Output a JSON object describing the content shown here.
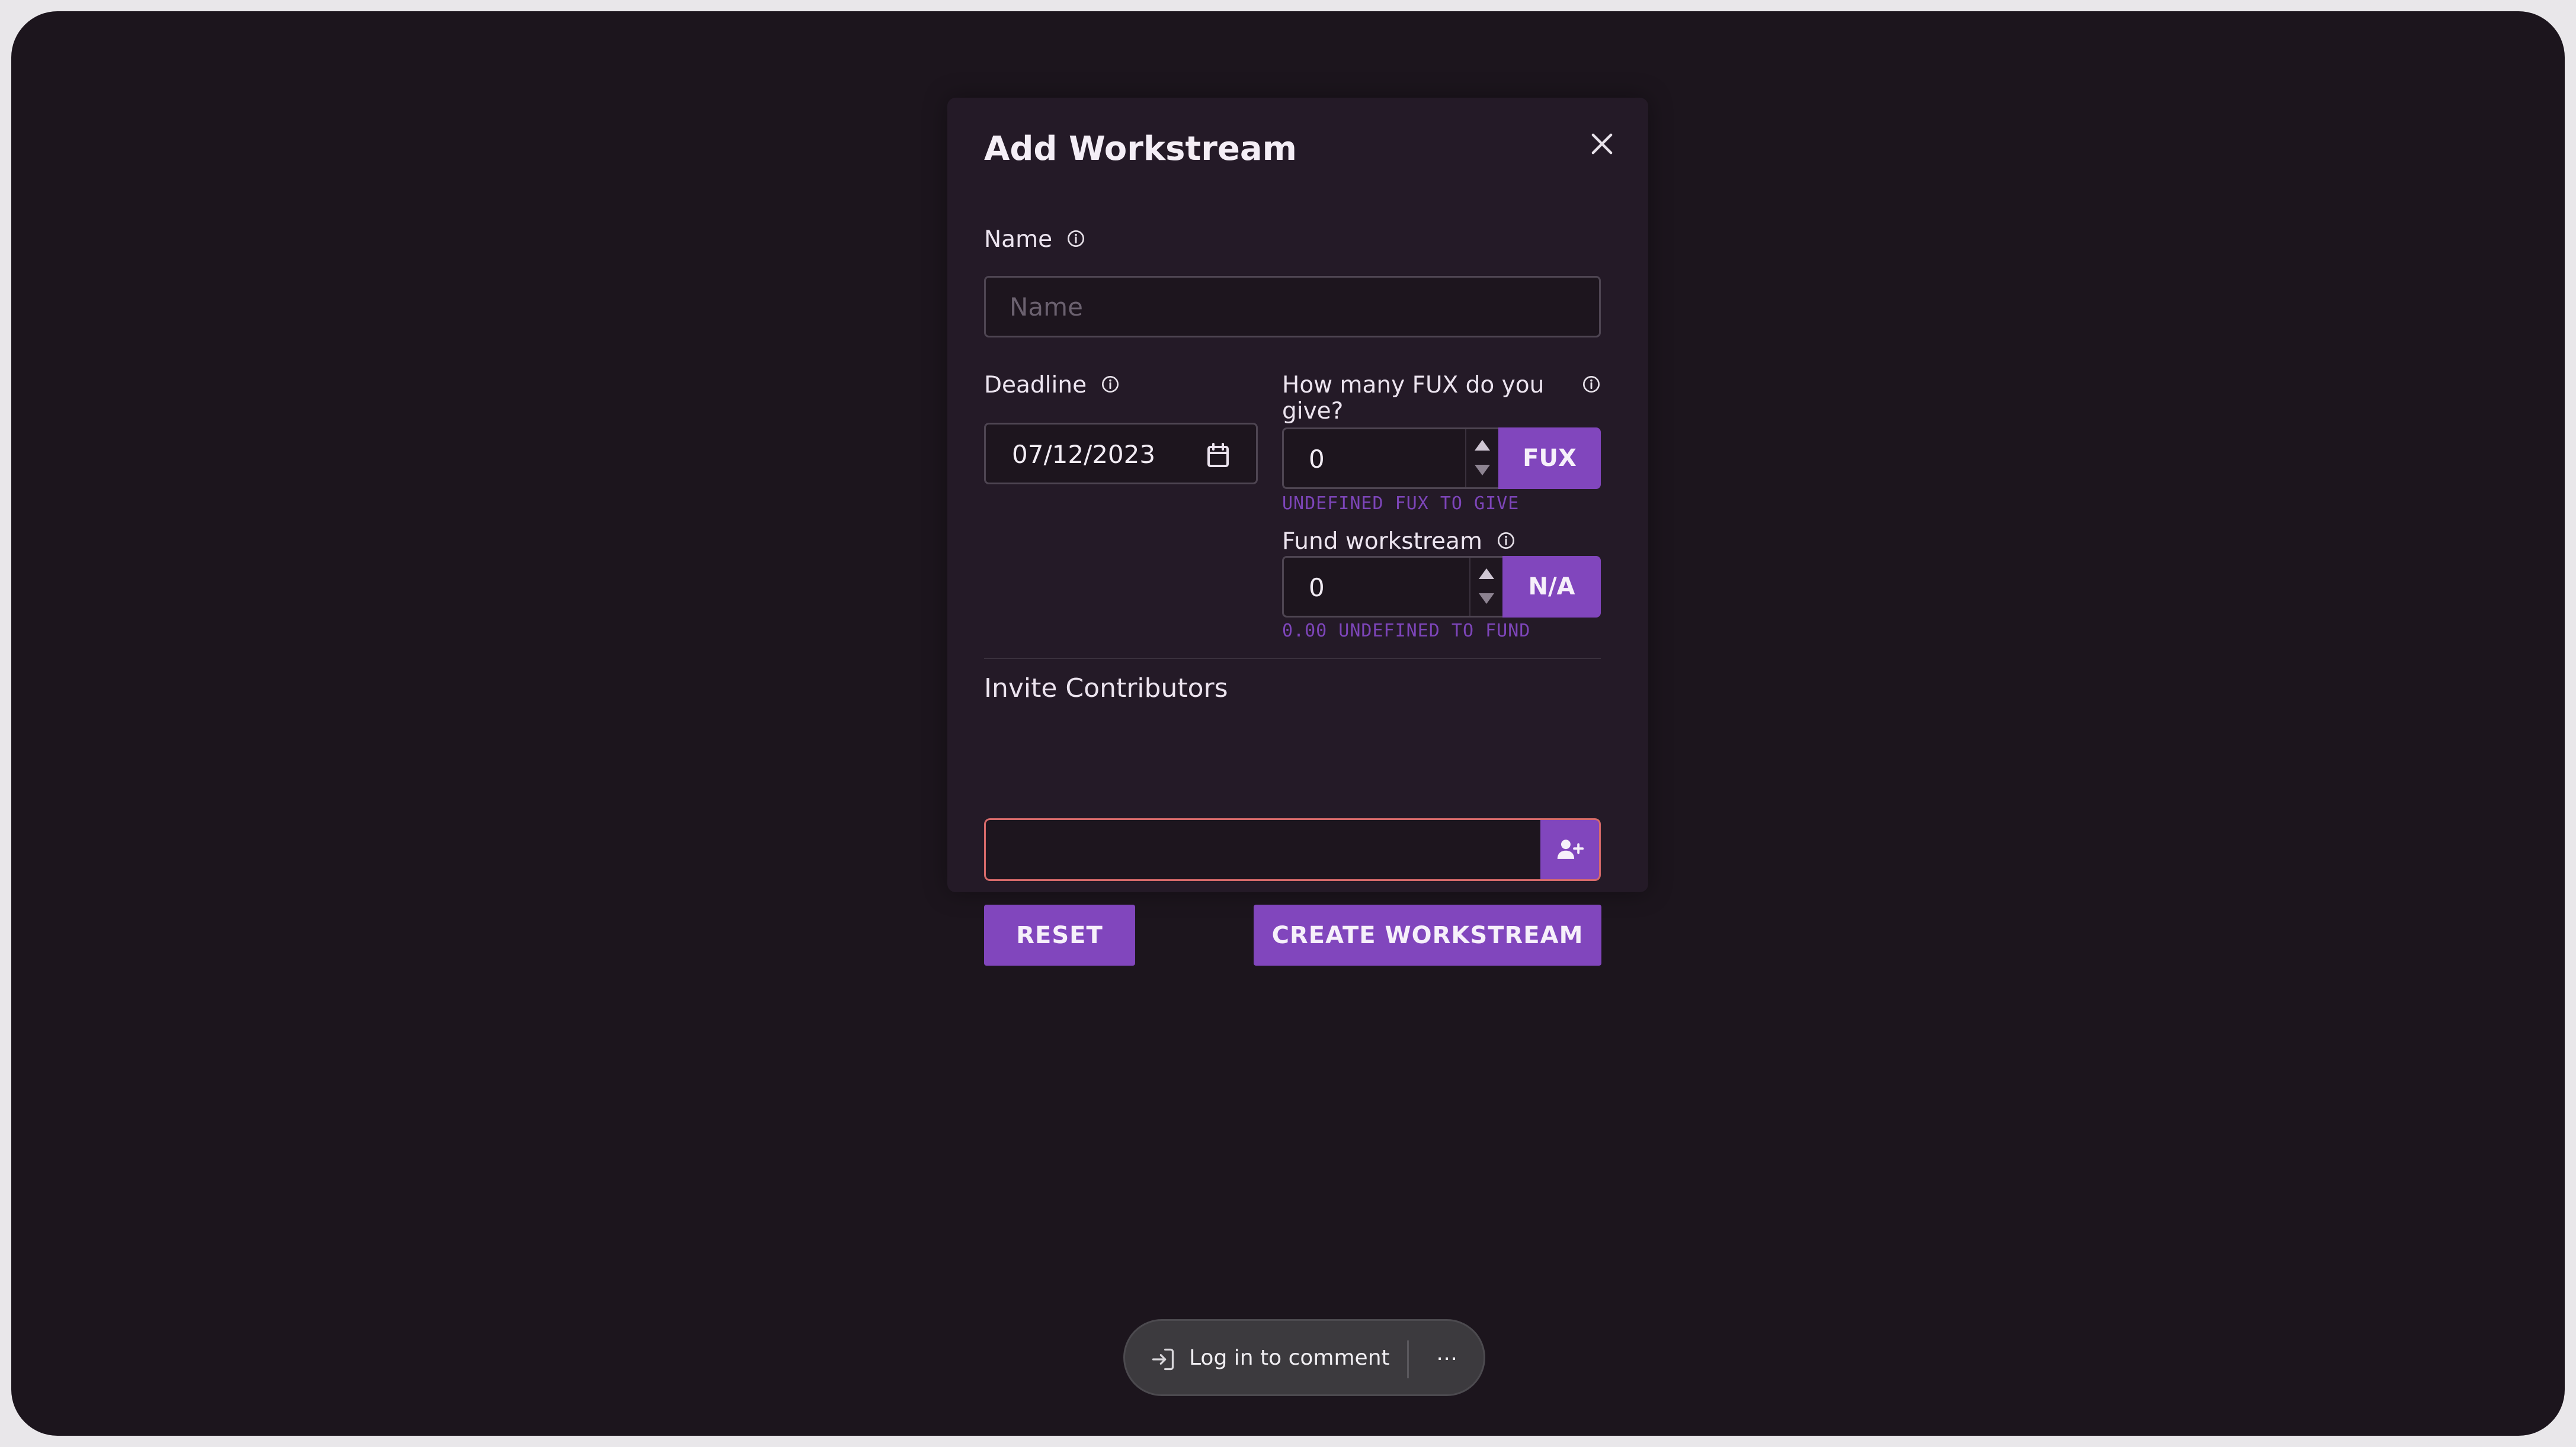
{
  "modal": {
    "title": "Add Workstream",
    "name_label": "Name",
    "name_placeholder": "Name",
    "name_value": "",
    "deadline_label": "Deadline",
    "deadline_value": "07/12/2023",
    "fux_label_line1": "How many FUX do you",
    "fux_label_line2": "give?",
    "fux_value": "0",
    "fux_unit": "FUX",
    "fux_hint": "UNDEFINED FUX TO GIVE",
    "fund_label": "Fund workstream",
    "fund_value": "0",
    "fund_unit": "N/A",
    "fund_hint": "0.00 UNDEFINED TO FUND",
    "invite_title": "Invite Contributors",
    "invite_value": "",
    "reset_label": "RESET",
    "create_label": "CREATE WORKSTREAM"
  },
  "comment_bar": {
    "login_label": "Log in to comment",
    "more_label": "⋯"
  },
  "icons": {
    "close": "close-icon",
    "info": "info-icon",
    "calendar": "calendar-icon",
    "add_user": "user-plus-icon",
    "login": "login-icon",
    "more": "more-icon"
  },
  "colors": {
    "background": "#1c151d",
    "modal": "#241a27",
    "accent": "#8146bd",
    "hint": "#7d45b9",
    "invalid_border": "#d66a6a"
  }
}
